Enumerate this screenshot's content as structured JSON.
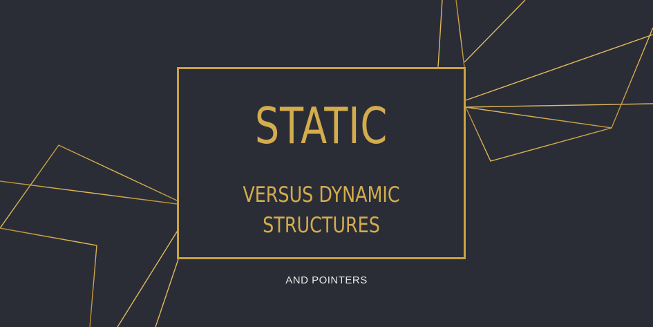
{
  "colors": {
    "background": "#2b2d36",
    "gold": "#d3ac4e",
    "tagline": "#e8e8ea"
  },
  "banner": {
    "title": "STATIC",
    "subtitle_line1": "VERSUS DYNAMIC",
    "subtitle_line2": "STRUCTURES",
    "tagline": "AND POINTERS"
  }
}
